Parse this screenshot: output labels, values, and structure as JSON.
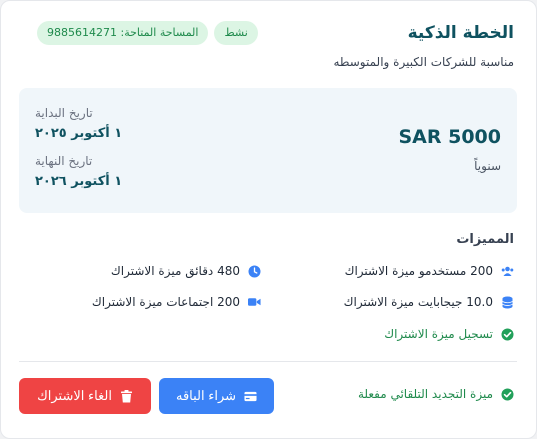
{
  "plan": {
    "title": "الخطة الذكية",
    "subtitle": "مناسبة للشركات الكبيرة والمتوسطه",
    "status_badge": "نشط",
    "space_badge": "المساحة المتاحة: 9885614271"
  },
  "pricing": {
    "price": "SAR 5000",
    "period": "سنوياً"
  },
  "dates": {
    "start_label": "تاريخ البداية",
    "start_value": "١ أكتوبر ٢٠٢٥",
    "end_label": "تاريخ النهاية",
    "end_value": "١ أكتوبر ٢٠٢٦"
  },
  "features": {
    "title": "المميزات",
    "users": "200 مستخدمو ميزة الاشتراك",
    "storage": "10.0 جيجابايت ميزة الاشتراك",
    "registration": "تسجيل ميزة الاشتراك",
    "minutes": "480 دقائق ميزة الاشتراك",
    "meetings": "200 اجتماعات ميزة الاشتراك"
  },
  "renewal": {
    "text": "ميزة التجديد التلقائي مفعلة"
  },
  "actions": {
    "buy_label": "شراء الباقه",
    "cancel_label": "الغاء الاشتراك"
  },
  "colors": {
    "primary_dark": "#0f5260",
    "accent_blue": "#3b82f6",
    "danger_red": "#ef4444",
    "success_green": "#1f8a4c",
    "badge_bg": "#dcf5e4"
  }
}
